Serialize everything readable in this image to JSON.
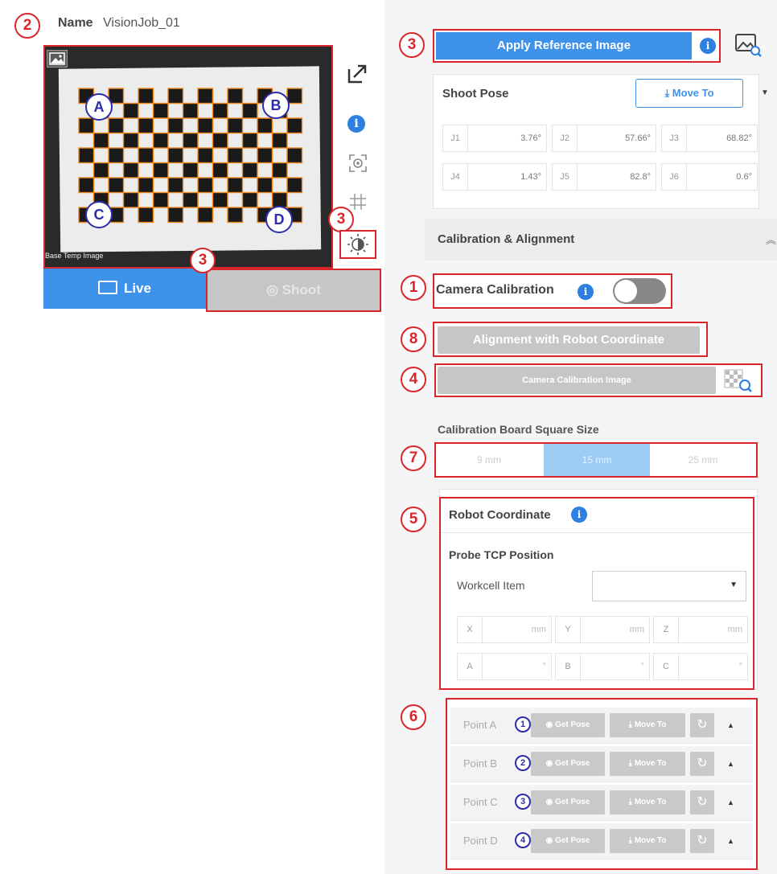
{
  "colors": {
    "annotation_red": "#d9262c",
    "letter_blue": "#2b2ea8",
    "primary_blue": "#3f92ea",
    "disabled_gray": "#c6c6c6"
  },
  "badges": {
    "b2": "2",
    "b3a": "3",
    "b3b": "3",
    "b3c": "3",
    "b3d": "3",
    "b1": "1",
    "b8": "8",
    "b4": "4",
    "b7": "7",
    "b5": "5",
    "b6": "6"
  },
  "header": {
    "name_label": "Name",
    "name_value": "VisionJob_01"
  },
  "image": {
    "overlay_text": "Base Temp Image",
    "corners": [
      "A",
      "B",
      "C",
      "D"
    ]
  },
  "side_icons": [
    "expand-icon",
    "info-icon",
    "focus-icon",
    "grid-icon",
    "brightness-icon"
  ],
  "left_buttons": {
    "live": "Live",
    "shoot": "Shoot"
  },
  "apply_ref": {
    "label": "Apply Reference Image"
  },
  "shoot_pose": {
    "title": "Shoot Pose",
    "move_to": "Move To",
    "joints": [
      {
        "label": "J1",
        "value": "3.76°"
      },
      {
        "label": "J2",
        "value": "57.66°"
      },
      {
        "label": "J3",
        "value": "68.82°"
      },
      {
        "label": "J4",
        "value": "1.43°"
      },
      {
        "label": "J5",
        "value": "82.8°"
      },
      {
        "label": "J6",
        "value": "0.6°"
      }
    ]
  },
  "calib_section": {
    "title": "Calibration & Alignment"
  },
  "camera_calibration": {
    "label": "Camera Calibration",
    "toggle_on": false
  },
  "alignment_button": {
    "label": "Alignment with Robot Coordinate"
  },
  "calib_image_button": {
    "label": "Camera Calibration Image"
  },
  "square_size": {
    "title": "Calibration Board Square Size",
    "options": [
      "9 mm",
      "15 mm",
      "25 mm"
    ],
    "selected": "15 mm"
  },
  "robot_coord": {
    "title": "Robot Coordinate",
    "probe_title": "Probe TCP Position",
    "workcell_label": "Workcell Item",
    "workcell_value": "",
    "fields": [
      {
        "label": "X",
        "unit": "mm"
      },
      {
        "label": "Y",
        "unit": "mm"
      },
      {
        "label": "Z",
        "unit": "mm"
      },
      {
        "label": "A",
        "unit": "°"
      },
      {
        "label": "B",
        "unit": "°"
      },
      {
        "label": "C",
        "unit": "°"
      }
    ]
  },
  "points": [
    {
      "label": "Point A",
      "num": "1",
      "get_pose": "Get Pose",
      "move_to": "Move To"
    },
    {
      "label": "Point B",
      "num": "2",
      "get_pose": "Get Pose",
      "move_to": "Move To"
    },
    {
      "label": "Point C",
      "num": "3",
      "get_pose": "Get Pose",
      "move_to": "Move To"
    },
    {
      "label": "Point D",
      "num": "4",
      "get_pose": "Get Pose",
      "move_to": "Move To"
    }
  ]
}
